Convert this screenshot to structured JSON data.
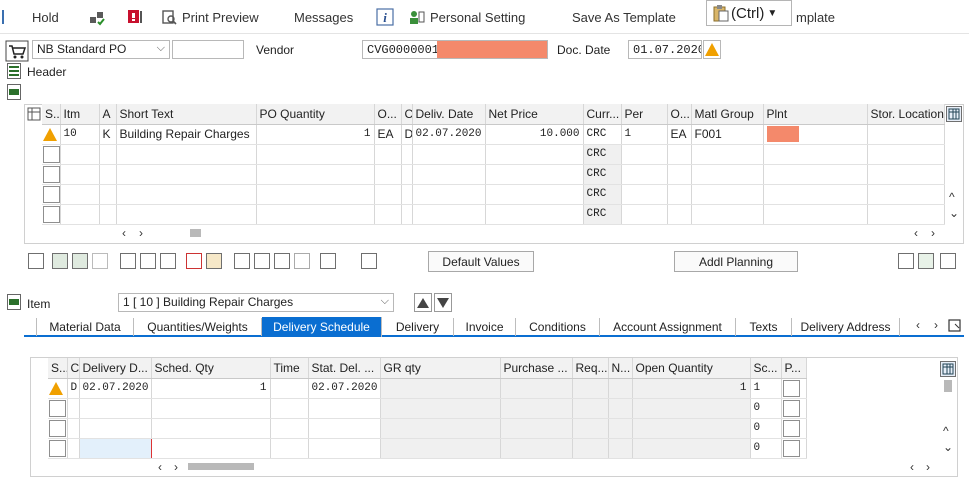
{
  "toolbar": {
    "hold": "Hold",
    "print_preview": "Print Preview",
    "messages": "Messages",
    "personal_setting": "Personal Setting",
    "save_as_template": "Save As Template",
    "template_suffix": "mplate",
    "ctrl_popup": "(Ctrl)"
  },
  "header": {
    "doc_type": "NB Standard PO",
    "vendor_label": "Vendor",
    "vendor_value": "CVG0000001",
    "doc_date_label": "Doc. Date",
    "doc_date_value": "01.07.2020",
    "section_label": "Header"
  },
  "items_table": {
    "columns": [
      "S..",
      "Itm",
      "A",
      "Short Text",
      "PO Quantity",
      "O...",
      "C",
      "Deliv. Date",
      "Net Price",
      "Curr...",
      "Per",
      "O...",
      "Matl Group",
      "Plnt",
      "Stor. Location"
    ],
    "rows": [
      {
        "itm": "10",
        "a": "K",
        "short_text": "Building Repair Charges",
        "qty": "1",
        "uom": "EA",
        "c": "D",
        "deliv_date": "02.07.2020",
        "net_price": "10.000",
        "curr": "CRC",
        "per": "1",
        "opu": "EA",
        "matl_group": "F001"
      },
      {
        "curr": "CRC"
      },
      {
        "curr": "CRC"
      },
      {
        "curr": "CRC"
      },
      {
        "curr": "CRC"
      }
    ]
  },
  "item_toolbar": {
    "default_values": "Default Values",
    "addl_planning": "Addl Planning"
  },
  "item_detail": {
    "label": "Item",
    "selected": "1 [ 10 ] Building Repair Charges",
    "tabs": [
      "Material Data",
      "Quantities/Weights",
      "Delivery Schedule",
      "Delivery",
      "Invoice",
      "Conditions",
      "Account Assignment",
      "Texts",
      "Delivery Address"
    ],
    "active_tab": "Delivery Schedule"
  },
  "schedule_table": {
    "columns": [
      "S...",
      "C",
      "Delivery D...",
      "Sched. Qty",
      "Time",
      "Stat. Del. ...",
      "GR qty",
      "Purchase ...",
      "Req...",
      "N...",
      "Open Quantity",
      "Sc...",
      "P..."
    ],
    "rows": [
      {
        "c": "D",
        "delivery_date": "02.07.2020",
        "sched_qty": "1",
        "stat_del": "02.07.2020",
        "open_qty": "1",
        "sc": "1"
      },
      {
        "sc": "0"
      },
      {
        "sc": "0"
      },
      {
        "sc": "0"
      }
    ]
  },
  "colors": {
    "accent": "#0a6ed1",
    "redacted": "#f4896b",
    "warning": "#f0a000"
  }
}
